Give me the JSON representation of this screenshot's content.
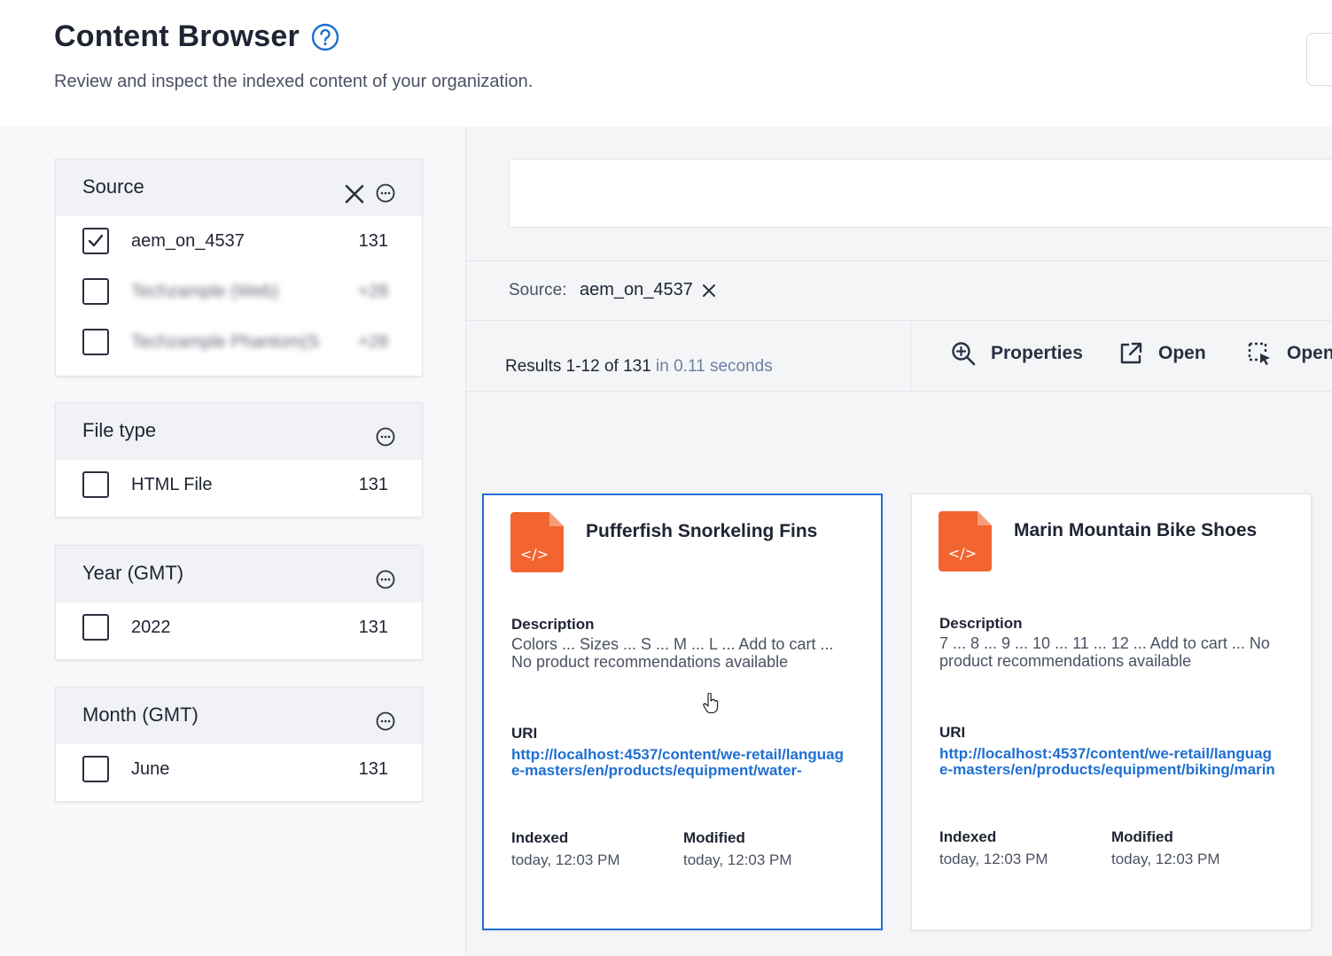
{
  "header": {
    "title": "Content Browser",
    "subtitle": "Review and inspect the indexed content of your organization."
  },
  "facets": {
    "source": {
      "title": "Source",
      "items": [
        {
          "label": "aem_on_4537",
          "count": "131",
          "checked": true
        },
        {
          "label": "Techzample (Web)",
          "count": "+28",
          "checked": false
        },
        {
          "label": "Techzample Phantom(S",
          "count": "+28",
          "checked": false
        }
      ]
    },
    "file_type": {
      "title": "File type",
      "items": [
        {
          "label": "HTML File",
          "count": "131",
          "checked": false
        }
      ]
    },
    "year": {
      "title": "Year (GMT)",
      "items": [
        {
          "label": "2022",
          "count": "131",
          "checked": false
        }
      ]
    },
    "month": {
      "title": "Month (GMT)",
      "items": [
        {
          "label": "June",
          "count": "131",
          "checked": false
        }
      ]
    }
  },
  "breadcrumb": {
    "label": "Source:",
    "value": "aem_on_4537"
  },
  "results": {
    "summary": "Results 1-12 of 131",
    "timing": "in 0.11 seconds"
  },
  "actions": {
    "properties": "Properties",
    "open": "Open",
    "open_in_browser": "Open"
  },
  "cards": [
    {
      "title": "Pufferfish Snorkeling Fins",
      "description_label": "Description",
      "description": "Colors ... Sizes ... S ... M ... L ... Add to cart ... No product recommendations available",
      "uri_label": "URI",
      "uri": "http://localhost:4537/content/we-retail/language-masters/en/products/equipment/water-",
      "indexed_label": "Indexed",
      "indexed": "today, 12:03 PM",
      "modified_label": "Modified",
      "modified": "today, 12:03 PM",
      "selected": true
    },
    {
      "title": "Marin Mountain Bike Shoes",
      "description_label": "Description",
      "description": "7 ... 8 ... 9 ... 10 ... 11 ... 12 ... Add to cart ... No product recommendations available",
      "uri_label": "URI",
      "uri": "http://localhost:4537/content/we-retail/language-masters/en/products/equipment/biking/marin",
      "indexed_label": "Indexed",
      "indexed": "today, 12:03 PM",
      "modified_label": "Modified",
      "modified": "today, 12:03 PM",
      "selected": false
    }
  ],
  "colors": {
    "accent": "#1f6fd1",
    "file_icon": "#f26430",
    "text": "#1f2433"
  }
}
